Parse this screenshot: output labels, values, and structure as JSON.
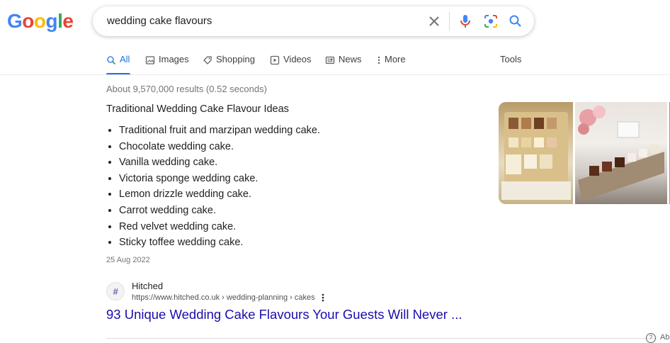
{
  "logo": {
    "letters": [
      "G",
      "o",
      "o",
      "g",
      "l",
      "e"
    ],
    "colors": [
      "#4285F4",
      "#EA4335",
      "#FBBC05",
      "#4285F4",
      "#34A853",
      "#EA4335"
    ]
  },
  "search": {
    "query": "wedding cake flavours"
  },
  "tabs": [
    {
      "label": "All",
      "icon": "search-icon"
    },
    {
      "label": "Images",
      "icon": "image-icon"
    },
    {
      "label": "Shopping",
      "icon": "tag-icon"
    },
    {
      "label": "Videos",
      "icon": "play-icon"
    },
    {
      "label": "News",
      "icon": "news-icon"
    },
    {
      "label": "More",
      "icon": "more-vertical-icon"
    }
  ],
  "tools_label": "Tools",
  "stats": "About 9,570,000 results (0.52 seconds)",
  "snippet": {
    "heading": "Traditional Wedding Cake Flavour Ideas",
    "items": [
      "Traditional fruit and marzipan wedding cake.",
      "Chocolate wedding cake.",
      "Vanilla wedding cake.",
      "Victoria sponge wedding cake.",
      "Lemon drizzle wedding cake.",
      "Carrot wedding cake.",
      "Red velvet wedding cake.",
      "Sticky toffee wedding cake."
    ],
    "date": "25 Aug 2022"
  },
  "result": {
    "favicon_glyph": "#",
    "site_name": "Hitched",
    "url": "https://www.hitched.co.uk › wedding-planning › cakes",
    "title": "93 Unique Wedding Cake Flavours Your Guests Will Never ..."
  },
  "footer": {
    "help_glyph": "?",
    "help_text": "Ab"
  },
  "colors": {
    "accent": "#1a73e8",
    "link": "#1a0dab"
  }
}
